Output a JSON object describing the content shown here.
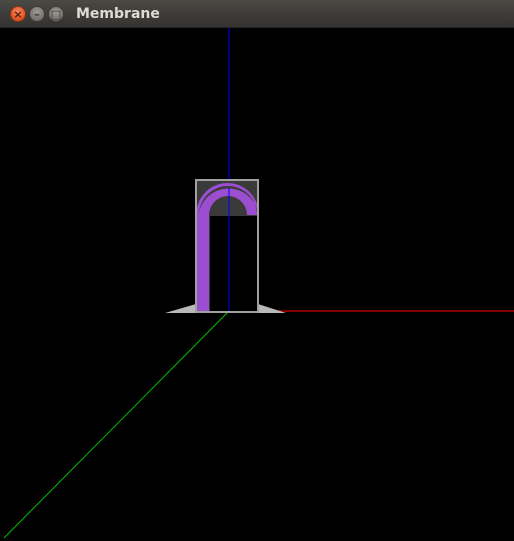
{
  "window": {
    "title": "Membrane",
    "buttons": {
      "close": "close-icon",
      "minimize": "minimize-icon",
      "maximize": "maximize-icon"
    }
  },
  "scene": {
    "background_color": "#000000",
    "axes": {
      "x_color": "#ff0000",
      "y_color": "#0000ff",
      "z_color": "#00c000"
    },
    "membrane": {
      "frame_color": "#a0a0a0",
      "fill_color": "#9b4fd0",
      "shadow_color": "#3a3a3a"
    }
  }
}
